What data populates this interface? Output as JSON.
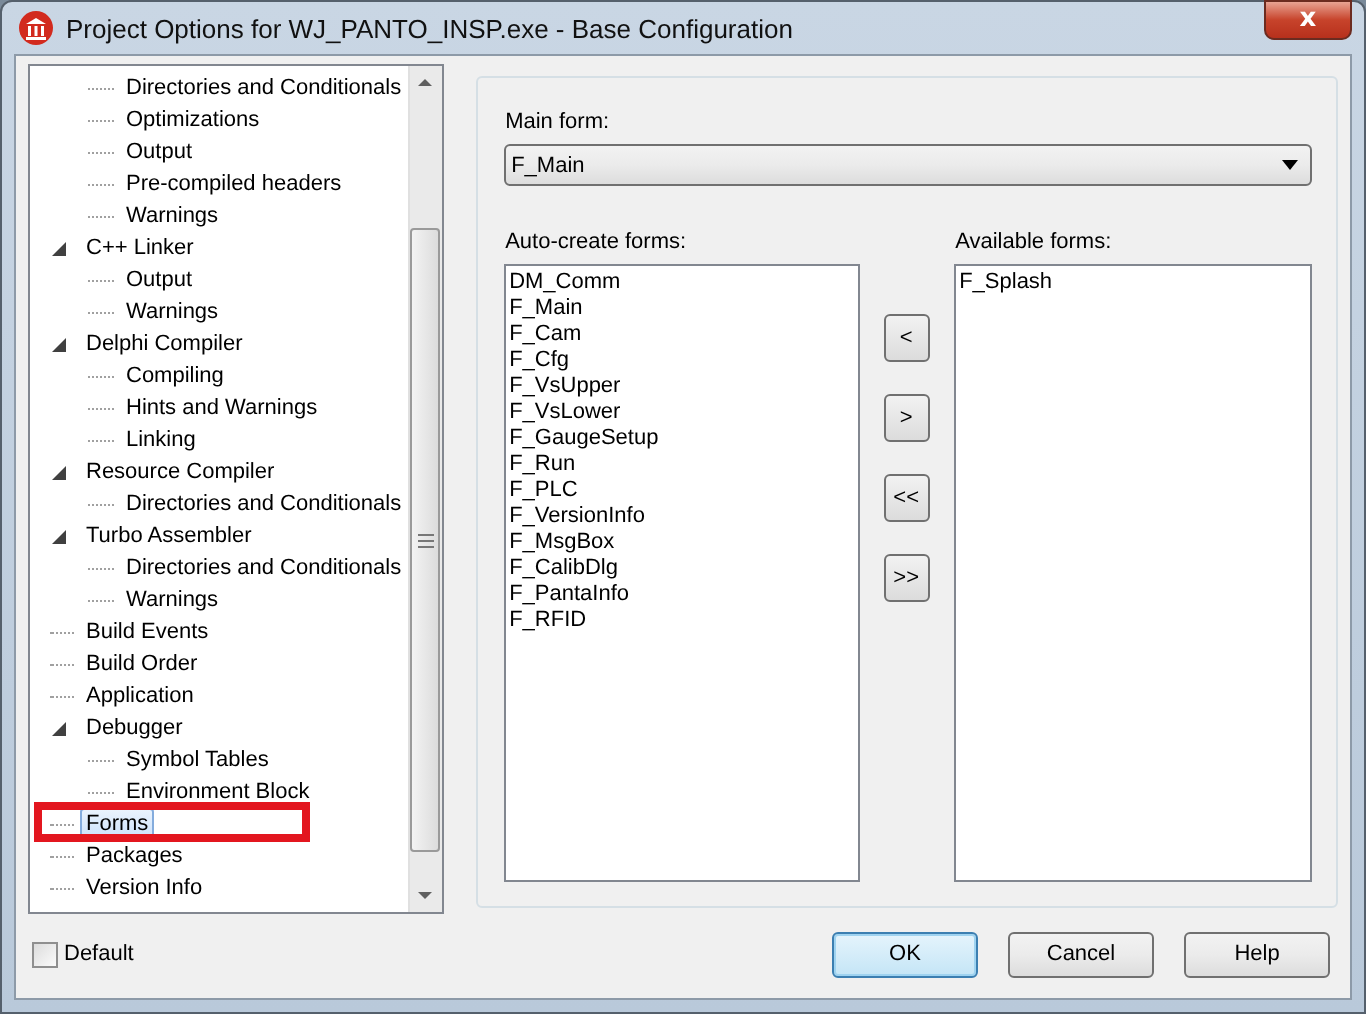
{
  "window": {
    "title": "Project Options for WJ_PANTO_INSP.exe - Base Configuration",
    "close": "x"
  },
  "tree": [
    {
      "children": [
        {
          "label": "Directories and Conditionals",
          "selected": false
        },
        {
          "label": "Optimizations",
          "selected": false
        },
        {
          "label": "Output",
          "selected": false
        },
        {
          "label": "Pre-compiled headers",
          "selected": false
        },
        {
          "label": "Warnings",
          "selected": false
        }
      ]
    },
    {
      "label": "C++ Linker",
      "selected": false,
      "expanded": true,
      "children": [
        {
          "label": "Output",
          "selected": false
        },
        {
          "label": "Warnings",
          "selected": false
        }
      ]
    },
    {
      "label": "Delphi Compiler",
      "selected": false,
      "expanded": true,
      "children": [
        {
          "label": "Compiling",
          "selected": false
        },
        {
          "label": "Hints and Warnings",
          "selected": false
        },
        {
          "label": "Linking",
          "selected": false
        }
      ]
    },
    {
      "label": "Resource Compiler",
      "selected": false,
      "expanded": true,
      "children": [
        {
          "label": "Directories and Conditionals",
          "selected": false
        }
      ]
    },
    {
      "label": "Turbo Assembler",
      "selected": false,
      "expanded": true,
      "children": [
        {
          "label": "Directories and Conditionals",
          "selected": false
        },
        {
          "label": "Warnings",
          "selected": false
        }
      ]
    },
    {
      "label": "Build Events",
      "selected": false
    },
    {
      "label": "Build Order",
      "selected": false
    },
    {
      "label": "Application",
      "selected": false
    },
    {
      "label": "Debugger",
      "selected": false,
      "expanded": true,
      "children": [
        {
          "label": "Symbol Tables",
          "selected": false
        },
        {
          "label": "Environment Block",
          "selected": false
        }
      ]
    },
    {
      "label": "Forms",
      "selected": true
    },
    {
      "label": "Packages",
      "selected": false
    },
    {
      "label": "Version Info",
      "selected": false
    }
  ],
  "default_checkbox": {
    "label": "Default",
    "checked": false
  },
  "main_form": {
    "label": "Main form:",
    "value": "F_Main"
  },
  "auto_create": {
    "label": "Auto-create forms:",
    "items": [
      "DM_Comm",
      "F_Main",
      "F_Cam",
      "F_Cfg",
      "F_VsUpper",
      "F_VsLower",
      "F_GaugeSetup",
      "F_Run",
      "F_PLC",
      "F_VersionInfo",
      "F_MsgBox",
      "F_CalibDlg",
      "F_PantaInfo",
      "F_RFID"
    ]
  },
  "move_buttons": [
    "<",
    ">",
    "<<",
    ">>"
  ],
  "available": {
    "label": "Available forms:",
    "items": [
      "F_Splash"
    ]
  },
  "buttons": [
    {
      "label": "OK",
      "default": true
    },
    {
      "label": "Cancel",
      "default": false
    },
    {
      "label": "Help",
      "default": false
    }
  ]
}
